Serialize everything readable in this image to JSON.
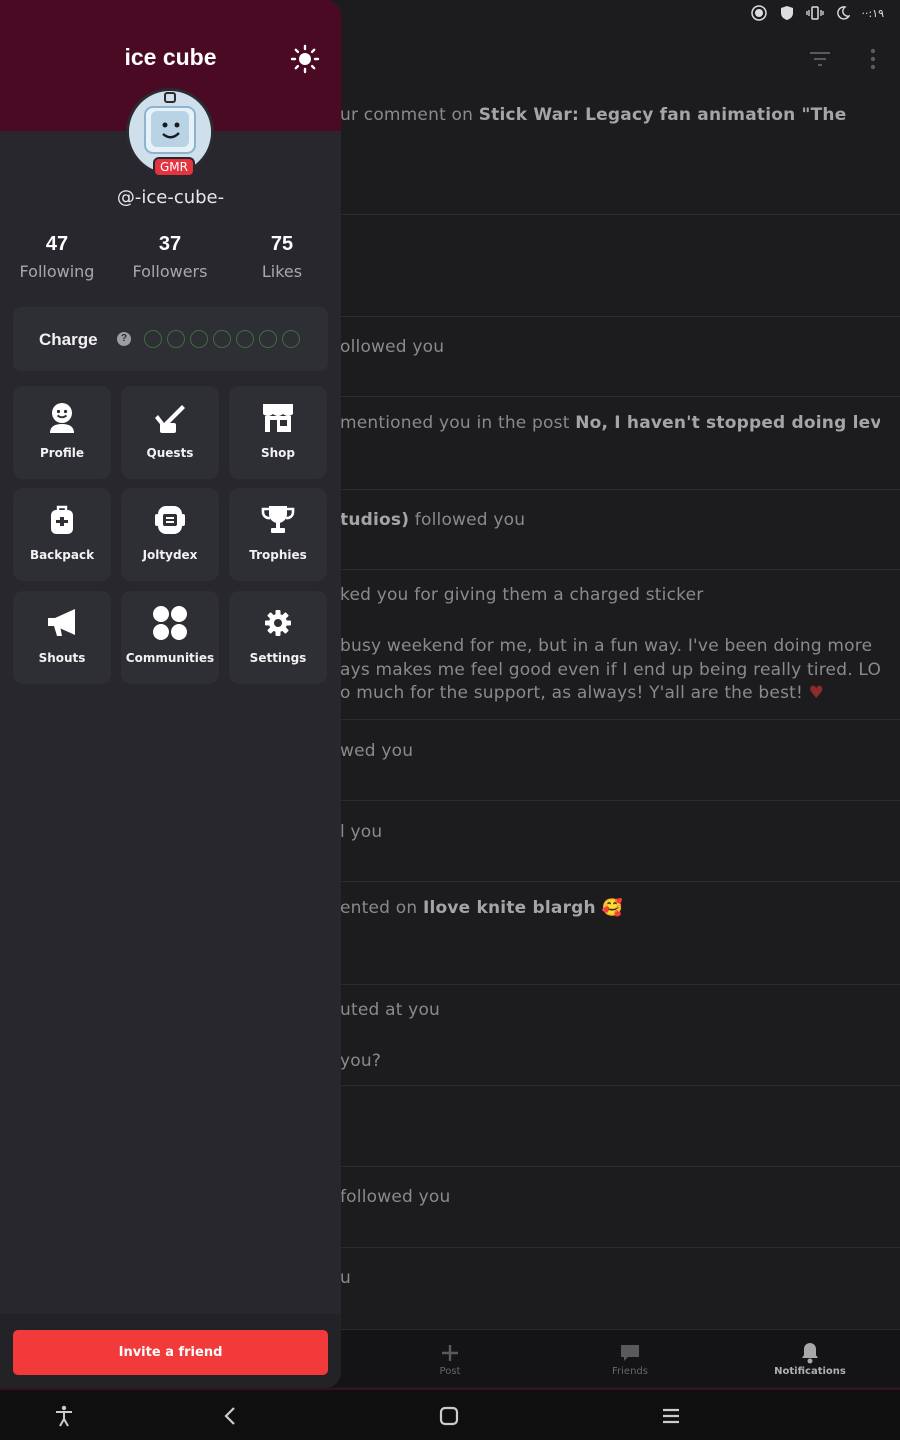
{
  "status_bar": {
    "time": "··:١٩"
  },
  "notifications": [
    {
      "text_pre": "ur comment on ",
      "bold": "Stick War: Legacy fan animation \"The",
      "text_post": ""
    },
    {
      "text_pre": "",
      "bold": "",
      "text_post": ""
    },
    {
      "text_pre": "ollowed you",
      "bold": "",
      "text_post": ""
    },
    {
      "text_pre": " mentioned you in the post ",
      "bold": "No, I haven't stopped doing levels, I",
      "text_post": ""
    },
    {
      "text_pre": "",
      "bold": "tudios)",
      "text_post": " followed you"
    },
    {
      "text_pre": "ked you for giving them a charged sticker",
      "bold": "",
      "text_post": "",
      "extra": [
        "busy weekend for me, but in a fun way. I've been doing more",
        "ays makes me feel good even if I end up being really tired. LOL Hope",
        "o much for the support, as always! Y'all are the best!"
      ]
    },
    {
      "text_pre": "wed you",
      "bold": "",
      "text_post": ""
    },
    {
      "text_pre": "l you",
      "bold": "",
      "text_post": ""
    },
    {
      "text_pre": "ented on ",
      "bold": "Ilove knite blargh",
      "text_post": " 🥰"
    },
    {
      "text_pre": "uted at you",
      "bold": "",
      "text_post": "",
      "extra": [
        "you?"
      ]
    },
    {
      "text_pre": "",
      "bold": "",
      "text_post": ""
    },
    {
      "text_pre": " followed you",
      "bold": "",
      "text_post": ""
    },
    {
      "text_pre": "u",
      "bold": "",
      "text_post": ""
    }
  ],
  "bottom_nav": [
    {
      "label": "Post",
      "icon": "plus-icon"
    },
    {
      "label": "Friends",
      "icon": "chat-icon"
    },
    {
      "label": "Notifications",
      "icon": "bell-icon",
      "active": true
    }
  ],
  "drawer": {
    "title": "ice cube",
    "handle": "@-ice-cube-",
    "badge": "GMR",
    "stats": [
      {
        "value": "47",
        "label": "Following"
      },
      {
        "value": "37",
        "label": "Followers"
      },
      {
        "value": "75",
        "label": "Likes"
      }
    ],
    "charge": {
      "label": "Charge",
      "help": "?",
      "filled": 0,
      "total": 7
    },
    "tiles": [
      {
        "label": "Profile",
        "icon": "profile-icon"
      },
      {
        "label": "Quests",
        "icon": "quests-icon"
      },
      {
        "label": "Shop",
        "icon": "shop-icon"
      },
      {
        "label": "Backpack",
        "icon": "backpack-icon"
      },
      {
        "label": "Joltydex",
        "icon": "joltydex-icon"
      },
      {
        "label": "Trophies",
        "icon": "trophy-icon"
      },
      {
        "label": "Shouts",
        "icon": "megaphone-icon"
      },
      {
        "label": "Communities",
        "icon": "communities-icon"
      },
      {
        "label": "Settings",
        "icon": "gear-icon"
      }
    ],
    "invite_label": "Invite a friend"
  },
  "colors": {
    "header": "#4a0a24",
    "drawer_bg": "#27272d",
    "card_bg": "#2e2e35",
    "accent_red": "#f23a3a"
  }
}
